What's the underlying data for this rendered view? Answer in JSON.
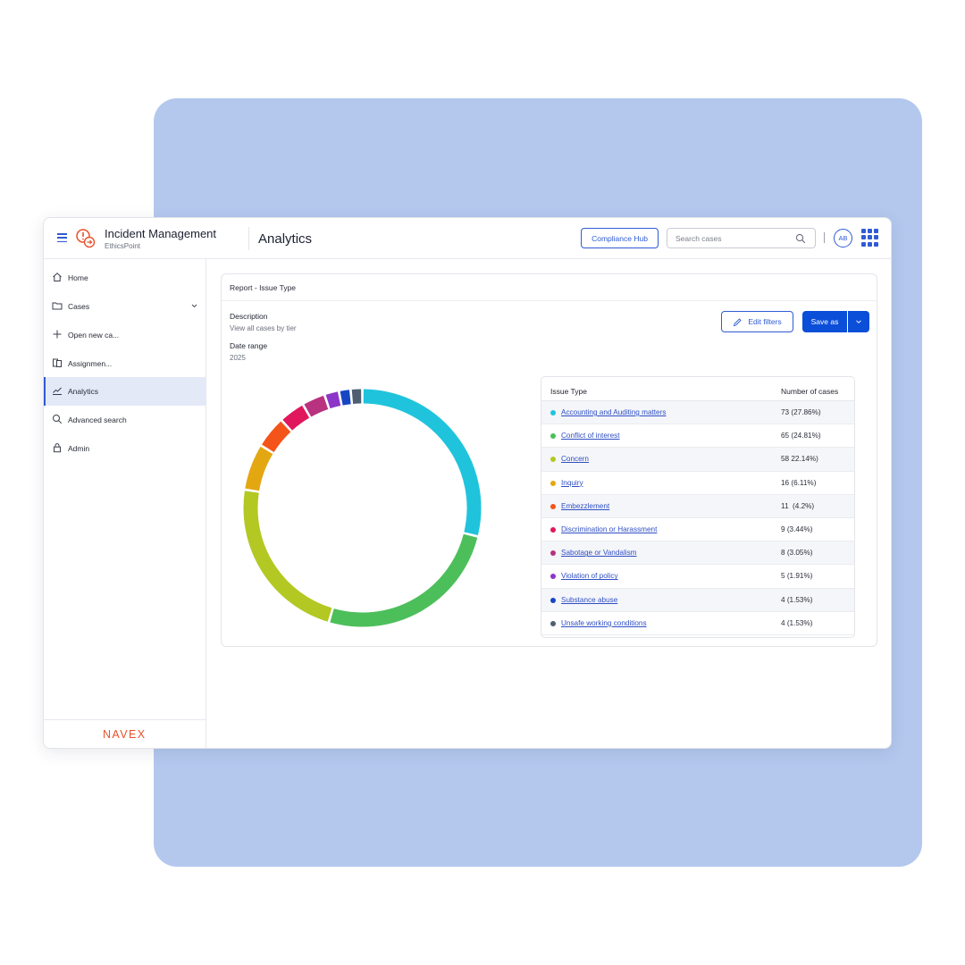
{
  "header": {
    "app_title": "Incident Management",
    "app_subtitle": "EthicsPoint",
    "page_title": "Analytics",
    "compliance_hub_label": "Compliance Hub",
    "search_placeholder": "Search cases",
    "avatar_initials": "AB"
  },
  "sidebar": {
    "items": [
      {
        "label": "Home",
        "icon": "home-icon"
      },
      {
        "label": "Cases",
        "icon": "folder-icon"
      },
      {
        "label": "Open new ca...",
        "icon": "plus-icon"
      },
      {
        "label": "Assignmen...",
        "icon": "assignments-icon"
      },
      {
        "label": "Analytics",
        "icon": "chart-icon",
        "active": true
      },
      {
        "label": "Advanced search",
        "icon": "search-icon"
      },
      {
        "label": "Admin",
        "icon": "lock-icon"
      }
    ],
    "brand": "NAVEX"
  },
  "report": {
    "title": "Report - Issue Type",
    "description_label": "Description",
    "description_value": "View all cases by tier",
    "date_range_label": "Date range",
    "date_range_value": "2025",
    "edit_filters_label": "Edit filters",
    "save_as_label": "Save as"
  },
  "table": {
    "col_issue": "Issue Type",
    "col_count": "Number of cases",
    "rows": [
      {
        "name": "Accounting and  Auditing matters",
        "value": "73 (27.86%)",
        "color": "#1fc4dc"
      },
      {
        "name": "Conflict of interest",
        "value": "65 (24.81%)",
        "color": "#4cbf5a"
      },
      {
        "name": "Concern",
        "value": "58 22.14%)",
        "color": "#b3c822"
      },
      {
        "name": "Inquiry",
        "value": "16 (6.11%)",
        "color": "#e3a712"
      },
      {
        "name": "Embezzlement",
        "value": "11  (4.2%)",
        "color": "#f4541a"
      },
      {
        "name": "Discrimination or Harassment",
        "value": "9 (3.44%)",
        "color": "#e0175d"
      },
      {
        "name": "Sabotage or Vandalism",
        "value": "8 (3.05%)",
        "color": "#b8327f"
      },
      {
        "name": "Violation of policy",
        "value": "5 (1.91%)",
        "color": "#8b36c9"
      },
      {
        "name": "Substance abuse",
        "value": "4 (1.53%)",
        "color": "#1646c4"
      },
      {
        "name": "Unsafe working conditions",
        "value": "4 (1.53%)",
        "color": "#4f5f72"
      }
    ]
  },
  "chart_data": {
    "type": "pie",
    "categories": [
      "Accounting and  Auditing matters",
      "Conflict of interest",
      "Concern",
      "Inquiry",
      "Embezzlement",
      "Discrimination or Harassment",
      "Sabotage or Vandalism",
      "Violation of policy",
      "Substance abuse",
      "Unsafe working conditions"
    ],
    "values": [
      73,
      65,
      58,
      16,
      11,
      9,
      8,
      5,
      4,
      4
    ],
    "colors": [
      "#1fc4dc",
      "#4cbf5a",
      "#b3c822",
      "#e3a712",
      "#f4541a",
      "#e0175d",
      "#b8327f",
      "#8b36c9",
      "#1646c4",
      "#4f5f72"
    ],
    "donut": true
  }
}
